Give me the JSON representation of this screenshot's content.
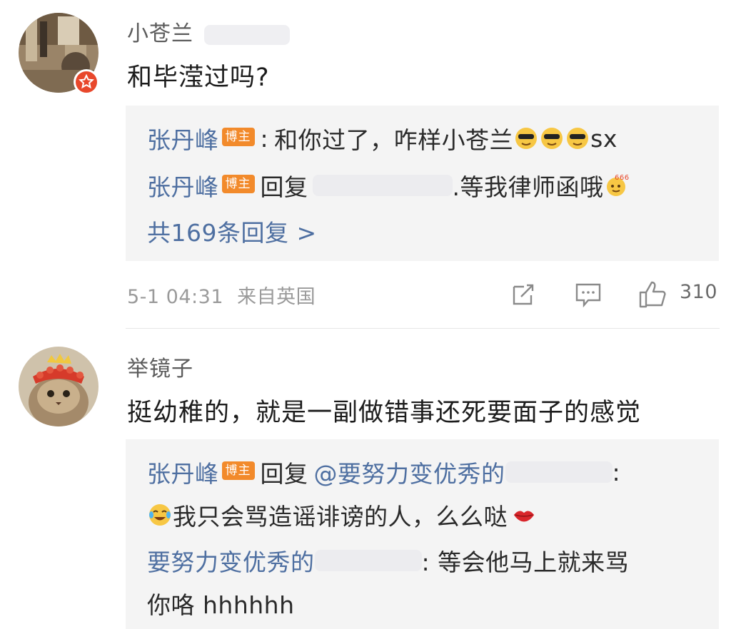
{
  "comments": [
    {
      "username": "小苍兰",
      "text": "和毕滢过吗?",
      "replies": [
        {
          "author": "张丹峰",
          "badge": "博主",
          "sep": ":",
          "text": "和你过了，咋样小苍兰",
          "tail": "sx",
          "emojis": [
            "cool-face-emoji",
            "cool-face-emoji",
            "cool-face-emoji"
          ]
        },
        {
          "author": "张丹峰",
          "badge": "博主",
          "prefix": "回复",
          "text": ".等我律师函哦",
          "emojis": [
            "666-face-emoji"
          ]
        }
      ],
      "more_replies": "共169条回复 >",
      "timestamp": "5-1 04:31",
      "source": "来自英国",
      "like_count": "310"
    },
    {
      "username": "举镜子",
      "text": "挺幼稚的，就是一副做错事还死要面子的感觉",
      "replies": [
        {
          "author": "张丹峰",
          "badge": "博主",
          "prefix": "回复",
          "mention": "@要努力变优秀的",
          "colon": ":",
          "text": "我只会骂造谣诽谤的人，么么哒"
        },
        {
          "author": "要努力变优秀的",
          "colon": ": 等会他马上就来骂",
          "text2": "你咯 hhhhhh"
        }
      ]
    }
  ],
  "colors": {
    "link": "#4e6fa1",
    "badge": "#f28a2b",
    "box": "#f4f4f4",
    "meta": "#9a9a9a"
  }
}
